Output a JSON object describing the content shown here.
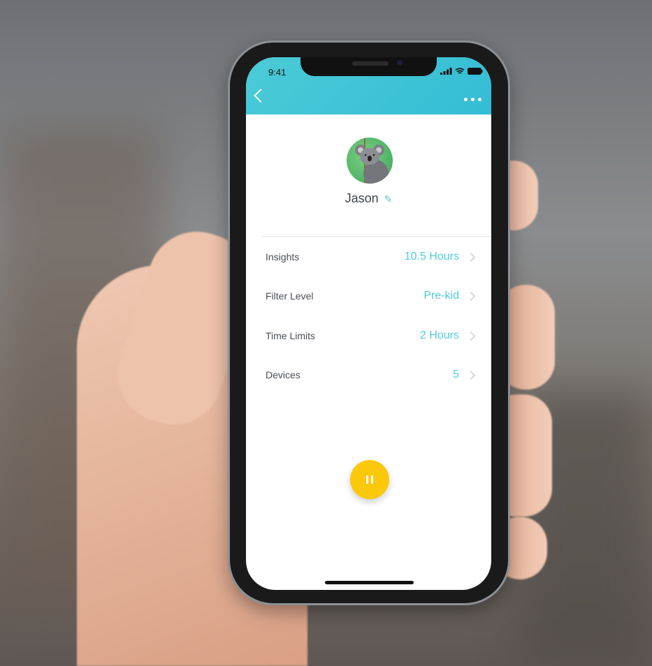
{
  "status_bar": {
    "time": "9:41"
  },
  "header": {
    "back_icon": "chevron-left-icon",
    "more_icon": "more-horizontal-icon"
  },
  "profile": {
    "name": "Jason",
    "avatar": "koala-avatar",
    "edit_icon": "pencil-icon"
  },
  "rows": [
    {
      "label": "Insights",
      "value": "10.5 Hours"
    },
    {
      "label": "Filter Level",
      "value": "Pre-kid"
    },
    {
      "label": "Time Limits",
      "value": "2 Hours"
    },
    {
      "label": "Devices",
      "value": "5"
    }
  ],
  "pause_button": {
    "icon": "pause-icon",
    "color": "#fcc80b"
  },
  "colors": {
    "accent": "#4fcbd9",
    "header": "#3ec3d6"
  }
}
